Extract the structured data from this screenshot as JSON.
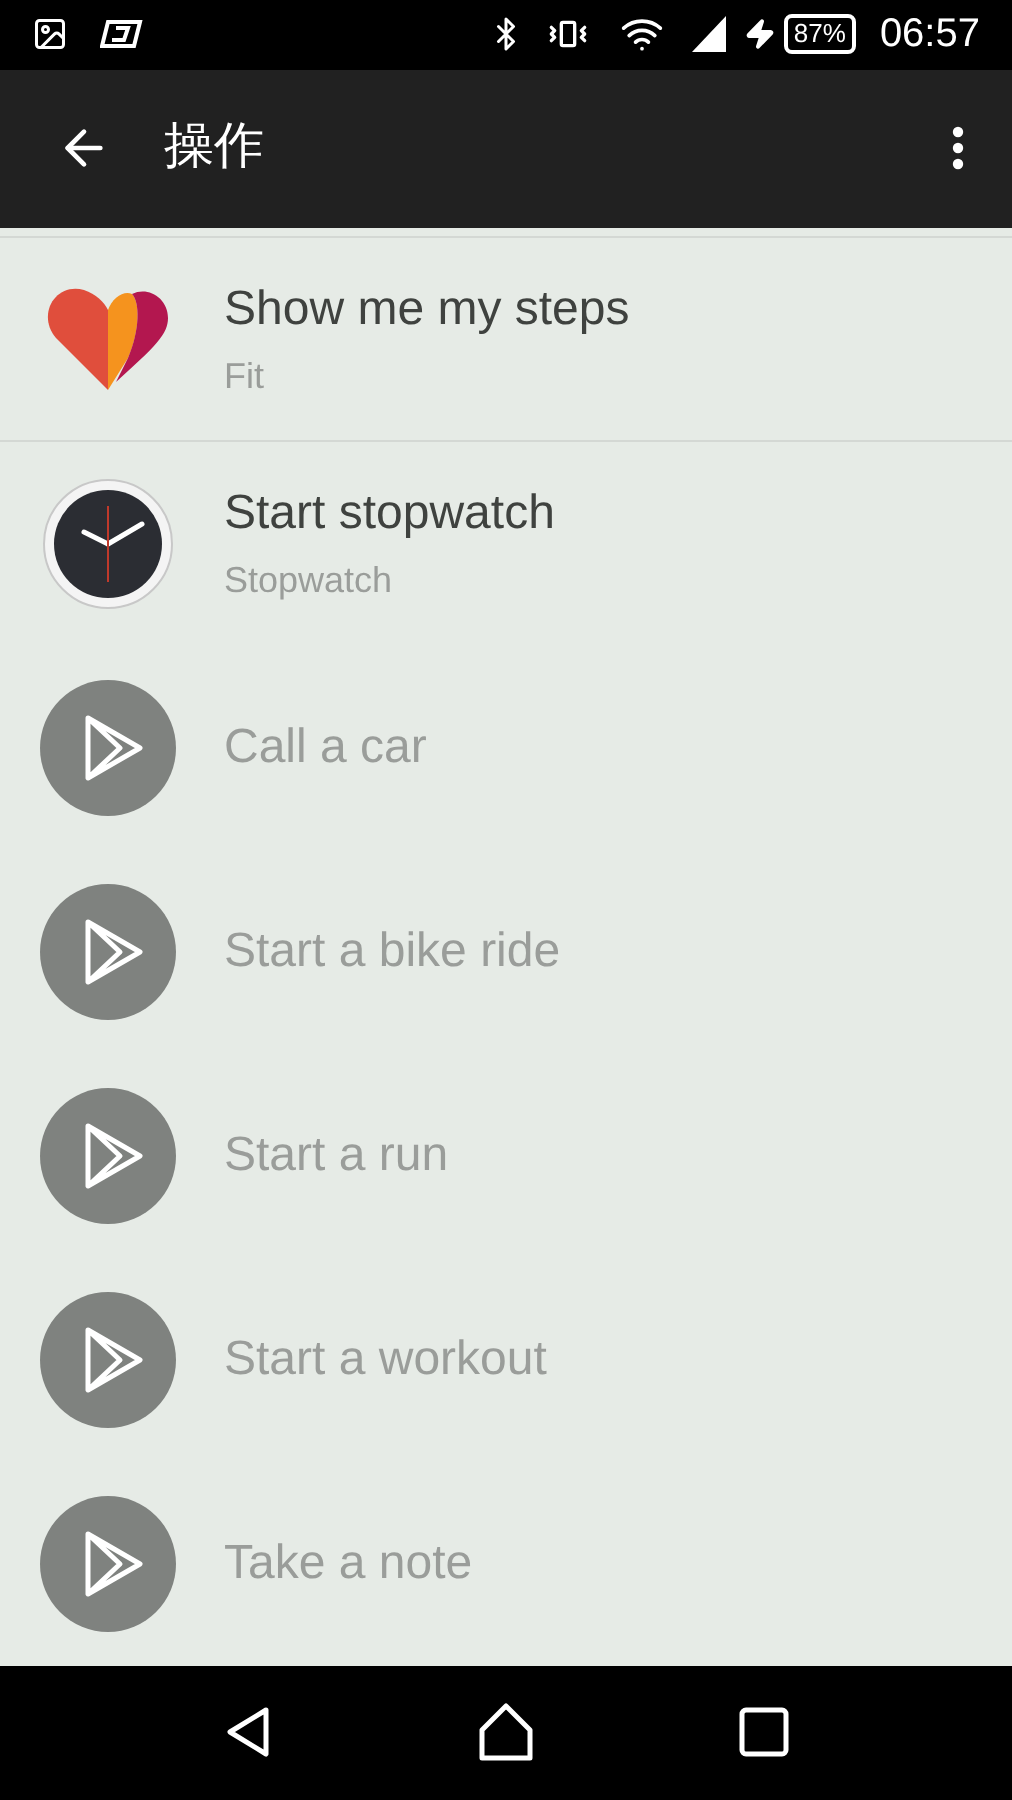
{
  "status_bar": {
    "battery": "87%",
    "time": "06:57"
  },
  "app_bar": {
    "title": "操作"
  },
  "actions": [
    {
      "kind": "fit",
      "title": "Show me my steps",
      "app": "Fit",
      "disabled": false,
      "divider": true
    },
    {
      "kind": "clock",
      "title": "Start stopwatch",
      "app": "Stopwatch",
      "disabled": false,
      "divider": false
    },
    {
      "kind": "play",
      "title": "Call a car",
      "disabled": true,
      "divider": false
    },
    {
      "kind": "play",
      "title": "Start a bike ride",
      "disabled": true,
      "divider": false
    },
    {
      "kind": "play",
      "title": "Start a run",
      "disabled": true,
      "divider": false
    },
    {
      "kind": "play",
      "title": "Start a workout",
      "disabled": true,
      "divider": false
    },
    {
      "kind": "play",
      "title": "Take a note",
      "disabled": true,
      "divider": false
    }
  ]
}
